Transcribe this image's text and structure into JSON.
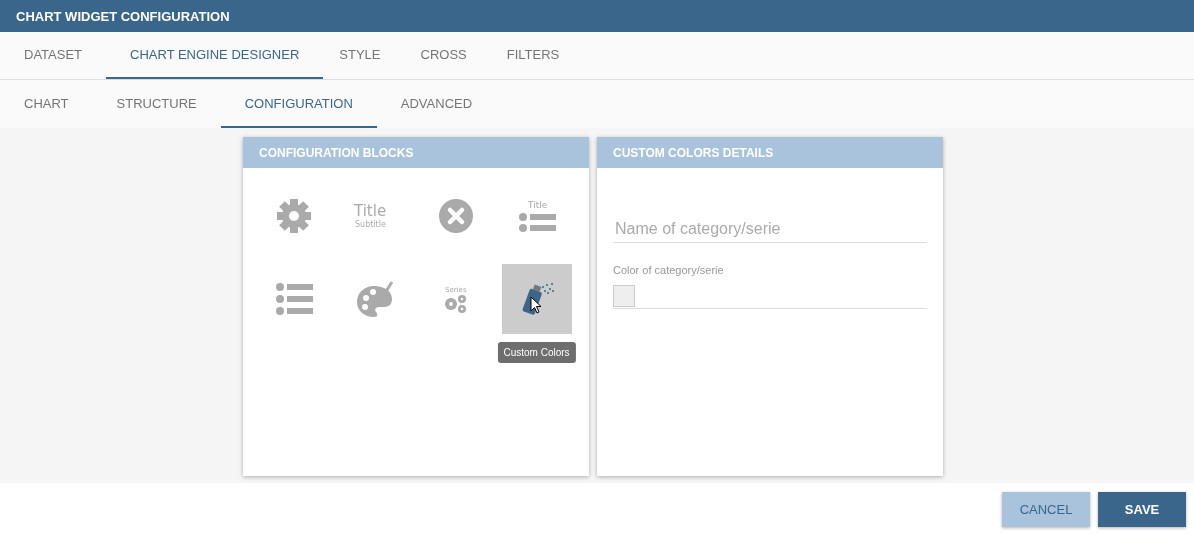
{
  "window": {
    "title": "CHART WIDGET CONFIGURATION"
  },
  "tabs": [
    {
      "label": "DATASET",
      "selected": false
    },
    {
      "label": "CHART ENGINE DESIGNER",
      "selected": true
    },
    {
      "label": "STYLE",
      "selected": false
    },
    {
      "label": "CROSS",
      "selected": false
    },
    {
      "label": "FILTERS",
      "selected": false
    }
  ],
  "subtabs": [
    {
      "label": "CHART",
      "selected": false
    },
    {
      "label": "STRUCTURE",
      "selected": false
    },
    {
      "label": "CONFIGURATION",
      "selected": true
    },
    {
      "label": "ADVANCED",
      "selected": false
    }
  ],
  "blocks_panel": {
    "title": "CONFIGURATION BLOCKS",
    "blocks": [
      {
        "kind": "gear",
        "selected": false
      },
      {
        "kind": "title",
        "selected": false,
        "title": "Title",
        "subtitle": "Subtitle"
      },
      {
        "kind": "close",
        "selected": false
      },
      {
        "kind": "legend-title",
        "selected": false,
        "title": "Title"
      },
      {
        "kind": "list",
        "selected": false
      },
      {
        "kind": "palette",
        "selected": false
      },
      {
        "kind": "series",
        "selected": false,
        "title": "Series"
      },
      {
        "kind": "spray",
        "selected": true,
        "tooltip": "Custom Colors"
      }
    ]
  },
  "details_panel": {
    "title": "CUSTOM COLORS DETAILS",
    "name_field": {
      "placeholder": "Name of category/serie"
    },
    "color_field": {
      "label": "Color of category/serie"
    }
  },
  "buttons": [
    {
      "label": "CANCEL",
      "kind": "secondary"
    },
    {
      "label": "SAVE",
      "kind": "primary"
    }
  ]
}
